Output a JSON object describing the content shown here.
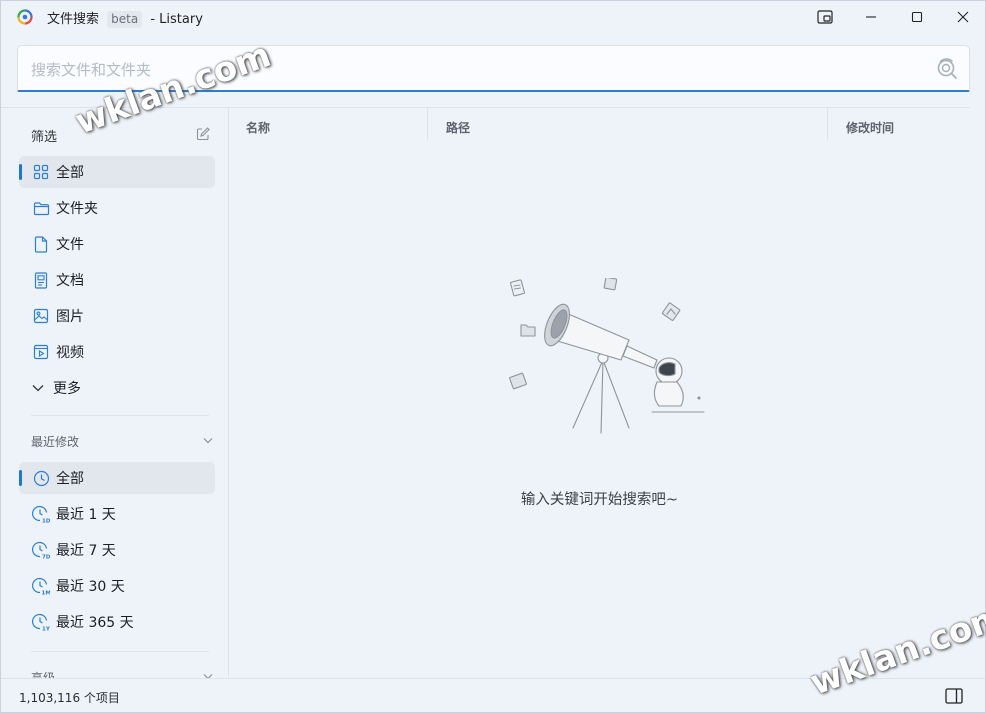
{
  "titlebar": {
    "app_name": "文件搜索",
    "badge": "beta",
    "suffix": "- Listary"
  },
  "search": {
    "placeholder": "搜索文件和文件夹",
    "value": ""
  },
  "sidebar": {
    "filter_title": "筛选",
    "filters": [
      {
        "label": "全部",
        "icon": "grid-icon"
      },
      {
        "label": "文件夹",
        "icon": "folder-icon"
      },
      {
        "label": "文件",
        "icon": "file-icon"
      },
      {
        "label": "文档",
        "icon": "document-icon"
      },
      {
        "label": "图片",
        "icon": "image-icon"
      },
      {
        "label": "视频",
        "icon": "video-icon"
      },
      {
        "label": "更多",
        "icon": "chevron-down-icon"
      }
    ],
    "recent_title": "最近修改",
    "recent": [
      {
        "label": "全部",
        "icon": "clock-icon",
        "tag": ""
      },
      {
        "label": "最近 1 天",
        "icon": "clock-1d-icon",
        "tag": "1D"
      },
      {
        "label": "最近 7 天",
        "icon": "clock-7d-icon",
        "tag": "7D"
      },
      {
        "label": "最近 30 天",
        "icon": "clock-1m-icon",
        "tag": "1M"
      },
      {
        "label": "最近 365 天",
        "icon": "clock-1y-icon",
        "tag": "1Y"
      }
    ],
    "advanced_title": "高级"
  },
  "table": {
    "columns": [
      "名称",
      "路径",
      "修改时间"
    ]
  },
  "empty_state": {
    "message": "输入关键词开始搜索吧~"
  },
  "status": {
    "count_text": "1,103,116 个项目"
  },
  "watermark": {
    "text": "wklan.com"
  },
  "colors": {
    "accent": "#1e78d2",
    "background": "#eef3fa"
  }
}
